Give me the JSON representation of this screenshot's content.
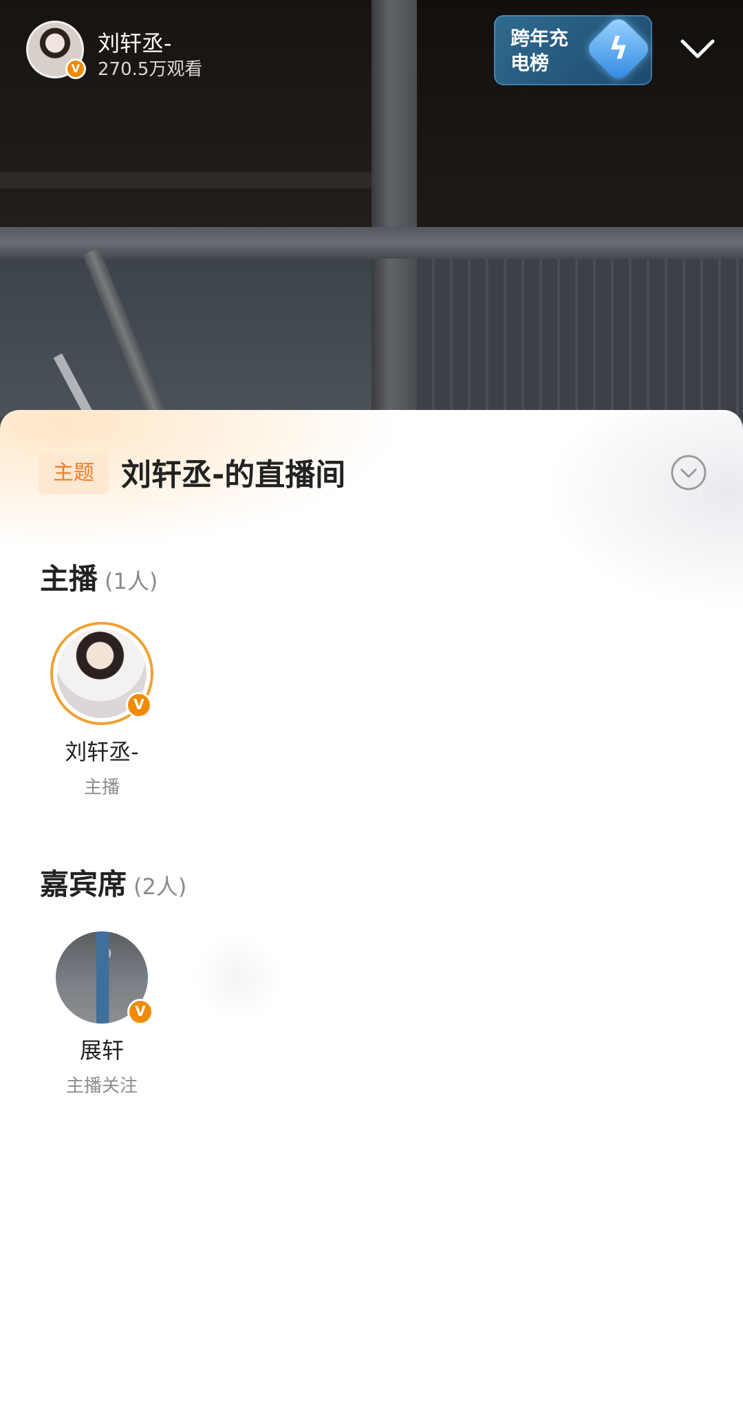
{
  "header": {
    "host_name": "刘轩丞-",
    "viewer_count": "270.5万观看",
    "verified_mark": "V",
    "rank_badge_label": "跨年充电榜",
    "rank_icon": "lightning-bolt-icon",
    "collapse_icon": "chevron-down-icon"
  },
  "sheet": {
    "topic_tag": "主题",
    "room_title": "刘轩丞-的直播间",
    "expand_icon": "circle-chevron-down-icon",
    "hosts_section": {
      "title": "主播",
      "count": "(1人)",
      "members": [
        {
          "name": "刘轩丞-",
          "role": "主播",
          "verified_mark": "V"
        }
      ]
    },
    "guests_section": {
      "title": "嘉宾席",
      "count": "(2人)",
      "members": [
        {
          "name": "展轩",
          "role": "主播关注",
          "verified_mark": "V"
        }
      ]
    }
  },
  "colors": {
    "accent_orange": "#ef7d22",
    "verified_badge": "#f08a00",
    "rank_badge_bg": "#2e6b8f",
    "topic_tag_bg": "#ffe8d2"
  }
}
